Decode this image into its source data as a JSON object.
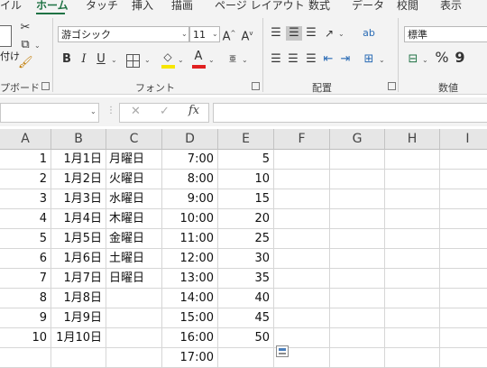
{
  "ribbon": {
    "tabs": [
      "イル",
      "ホーム",
      "タッチ",
      "挿入",
      "描画",
      "ページ レイアウト",
      "数式",
      "データ",
      "校閲",
      "表示"
    ],
    "clipboard": {
      "paste_label": "付け",
      "group_label": "プボード"
    },
    "font": {
      "name": "游ゴシック",
      "size": "11",
      "group_label": "フォント",
      "bold": "B",
      "italic": "I",
      "underline": "U",
      "font_color": "#e02020",
      "fill_color": "#f7e600"
    },
    "alignment": {
      "group_label": "配置"
    },
    "number": {
      "format": "標準",
      "percent": "%",
      "comma": "9",
      "group_label": "数値"
    }
  },
  "formula_bar": {
    "fx": "fx",
    "cancel": "✕",
    "enter": "✓"
  },
  "columns": [
    "A",
    "B",
    "C",
    "D",
    "E",
    "F",
    "G",
    "H",
    "I"
  ],
  "rows": [
    {
      "a": "1",
      "b": "1月1日",
      "c": "月曜日",
      "d": "7:00",
      "e": "5"
    },
    {
      "a": "2",
      "b": "1月2日",
      "c": "火曜日",
      "d": "8:00",
      "e": "10"
    },
    {
      "a": "3",
      "b": "1月3日",
      "c": "水曜日",
      "d": "9:00",
      "e": "15"
    },
    {
      "a": "4",
      "b": "1月4日",
      "c": "木曜日",
      "d": "10:00",
      "e": "20"
    },
    {
      "a": "5",
      "b": "1月5日",
      "c": "金曜日",
      "d": "11:00",
      "e": "25"
    },
    {
      "a": "6",
      "b": "1月6日",
      "c": "土曜日",
      "d": "12:00",
      "e": "30"
    },
    {
      "a": "7",
      "b": "1月7日",
      "c": "日曜日",
      "d": "13:00",
      "e": "35"
    },
    {
      "a": "8",
      "b": "1月8日",
      "c": "",
      "d": "14:00",
      "e": "40"
    },
    {
      "a": "9",
      "b": "1月9日",
      "c": "",
      "d": "15:00",
      "e": "45"
    },
    {
      "a": "10",
      "b": "1月10日",
      "c": "",
      "d": "16:00",
      "e": "50"
    },
    {
      "a": "",
      "b": "",
      "c": "",
      "d": "17:00",
      "e": ""
    }
  ]
}
